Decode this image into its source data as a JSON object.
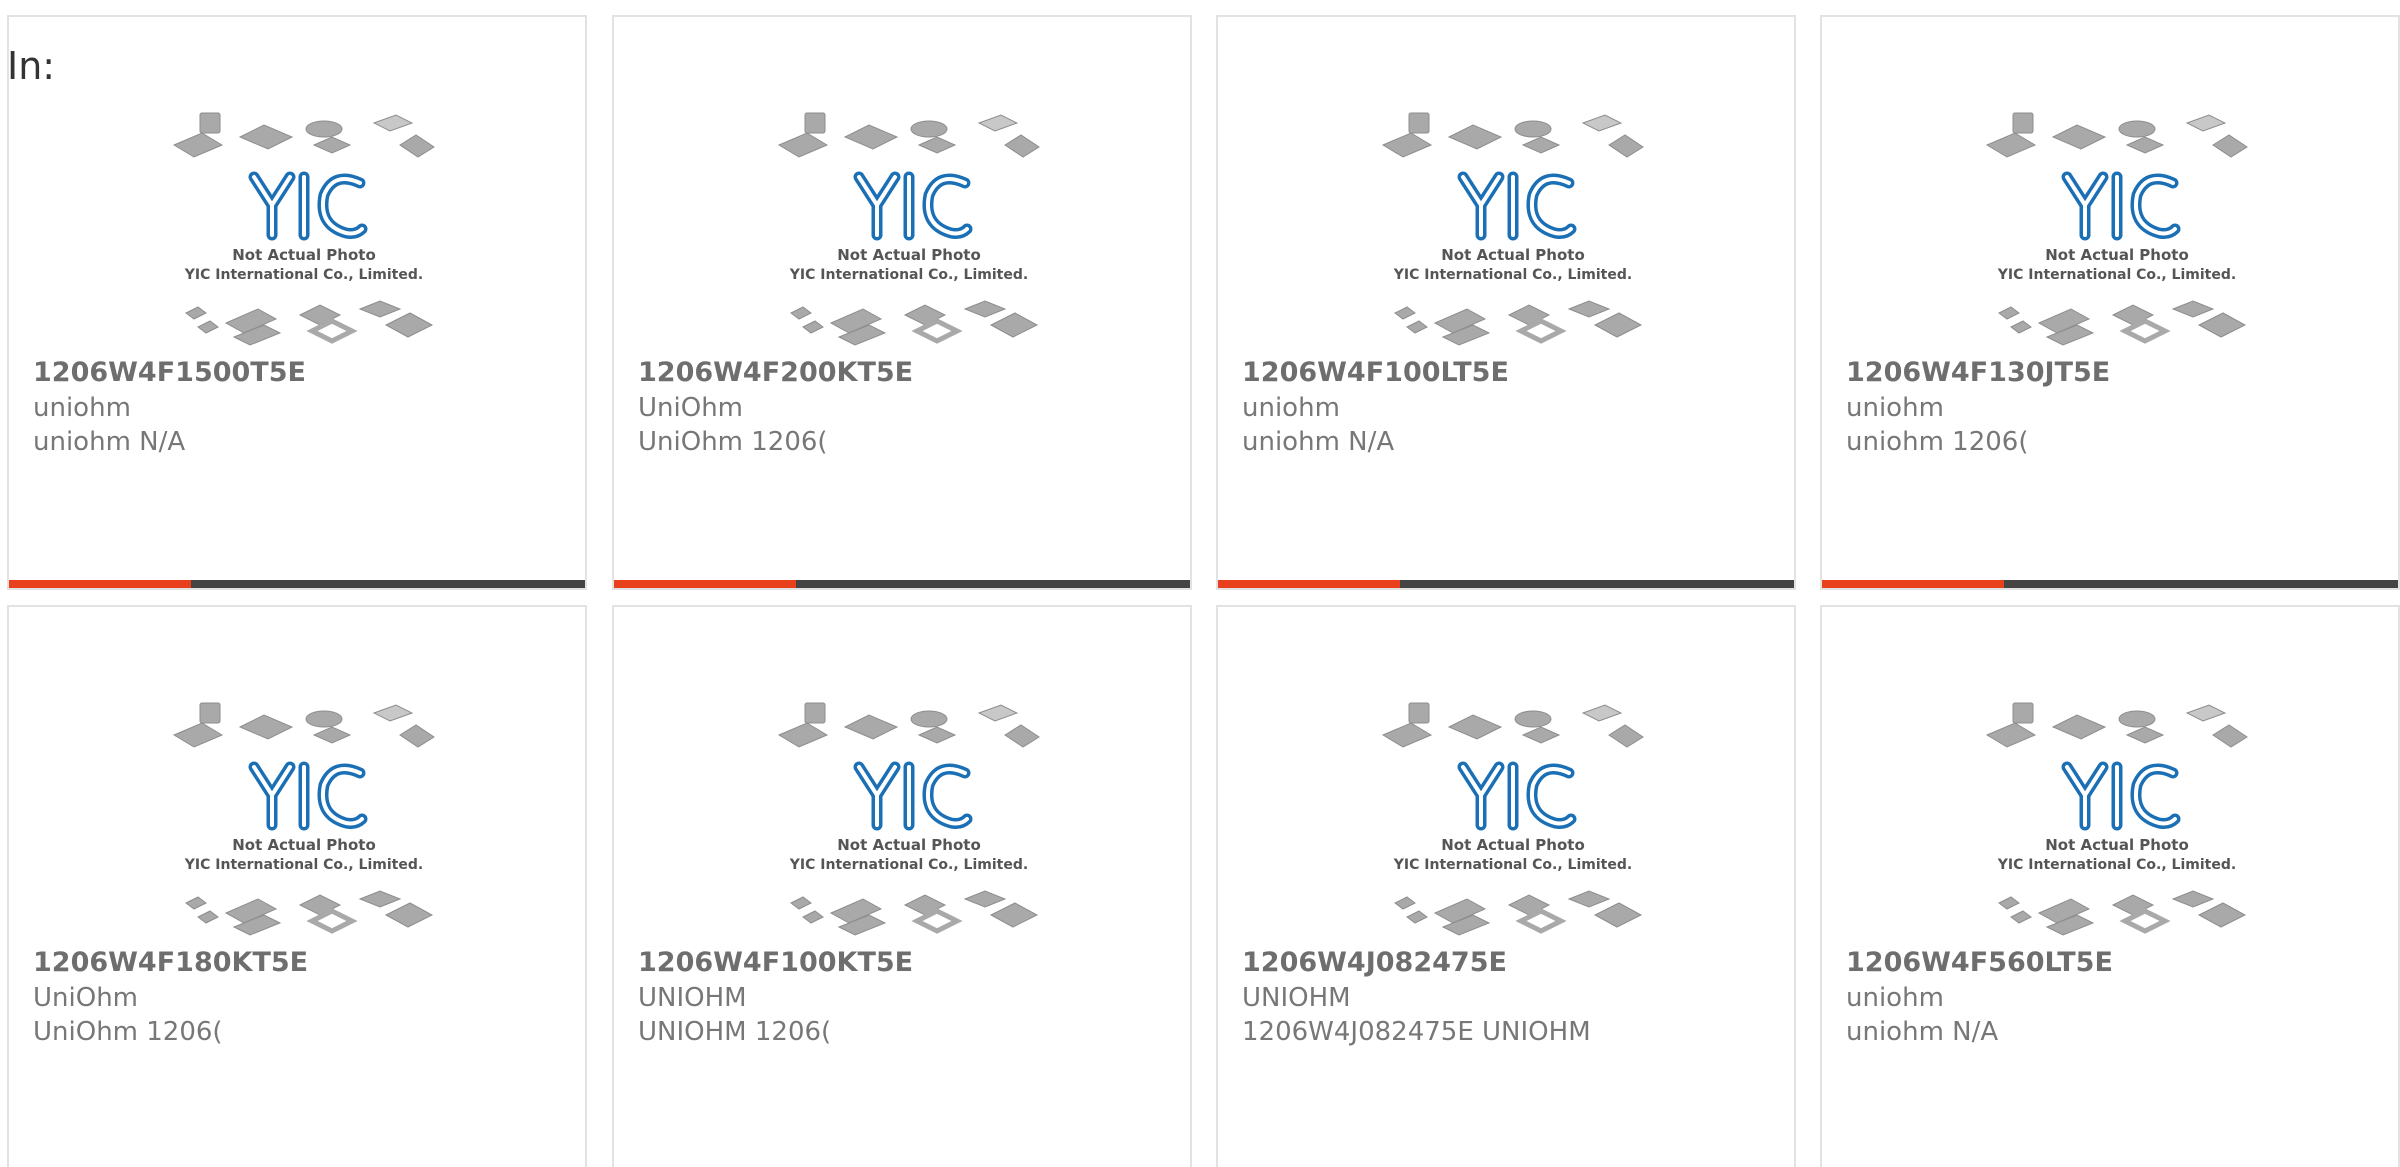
{
  "header": {
    "in_label": "In:"
  },
  "colors": {
    "accent": "#e8401c",
    "bar": "#444444",
    "logo": "#1a6fb5"
  },
  "thumbnail": {
    "icon": "yic-placeholder-logo",
    "caption_line1": "Not Actual Photo",
    "caption_line2": "YIC International Co., Limited."
  },
  "products": [
    {
      "part": "1206W4F1500T5E",
      "maker": "uniohm",
      "desc": "uniohm N/A"
    },
    {
      "part": "1206W4F200KT5E",
      "maker": "UniOhm",
      "desc": "UniOhm 1206("
    },
    {
      "part": "1206W4F100LT5E",
      "maker": "uniohm",
      "desc": "uniohm N/A"
    },
    {
      "part": "1206W4F130JT5E",
      "maker": "uniohm",
      "desc": "uniohm 1206("
    },
    {
      "part": "1206W4F180KT5E",
      "maker": "UniOhm",
      "desc": "UniOhm 1206("
    },
    {
      "part": "1206W4F100KT5E",
      "maker": "UNIOHM",
      "desc": "UNIOHM 1206("
    },
    {
      "part": "1206W4J082475E",
      "maker": "UNIOHM",
      "desc": "1206W4J082475E UNIOHM"
    },
    {
      "part": "1206W4F560LT5E",
      "maker": "uniohm",
      "desc": "uniohm N/A"
    }
  ]
}
